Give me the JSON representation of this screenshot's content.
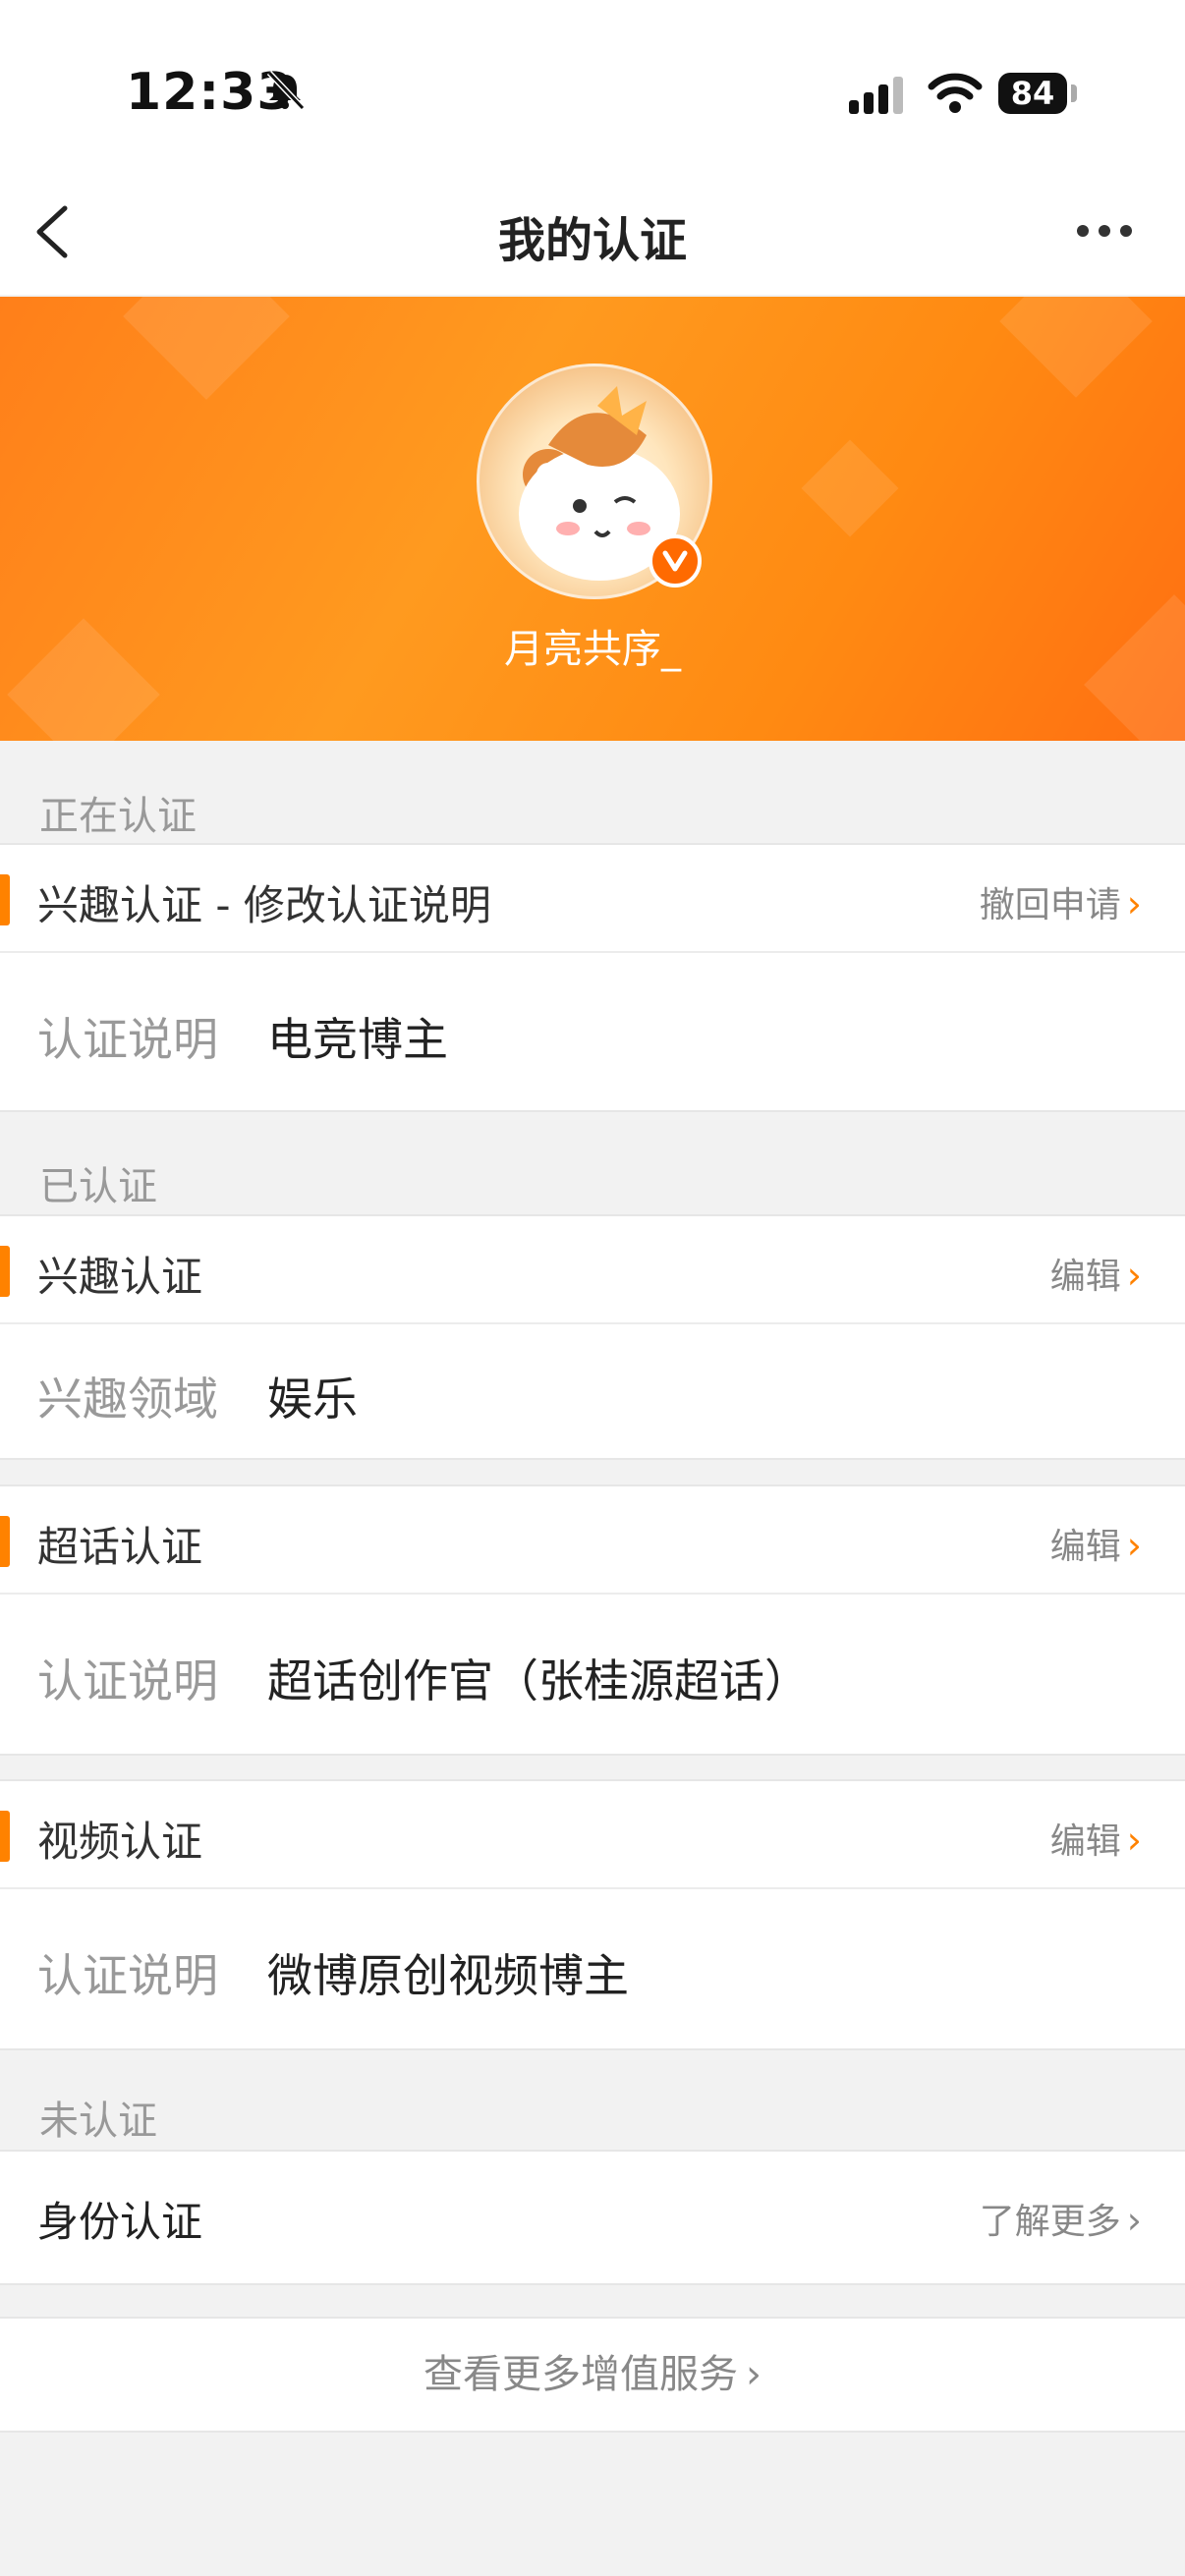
{
  "status_bar": {
    "time": "12:33",
    "battery": "84"
  },
  "nav": {
    "title": "我的认证",
    "back_icon": "chevron-left-icon",
    "more_icon": "more-dots-icon"
  },
  "profile": {
    "username": "月亮共序_",
    "verified_badge": "V"
  },
  "sections": {
    "in_progress": {
      "label": "正在认证",
      "card": {
        "title": "兴趣认证 - 修改认证说明",
        "action": "撤回申请",
        "detail_label": "认证说明",
        "detail_value": "电竞博主"
      }
    },
    "verified": {
      "label": "已认证",
      "cards": [
        {
          "title": "兴趣认证",
          "action": "编辑",
          "detail_label": "兴趣领域",
          "detail_value": "娱乐"
        },
        {
          "title": "超话认证",
          "action": "编辑",
          "detail_label": "认证说明",
          "detail_value": "超话创作官（张桂源超话）"
        },
        {
          "title": "视频认证",
          "action": "编辑",
          "detail_label": "认证说明",
          "detail_value": "微博原创视频博主"
        }
      ]
    },
    "unverified": {
      "label": "未认证",
      "item": {
        "title": "身份认证",
        "action": "了解更多"
      }
    }
  },
  "footer": {
    "more_services": "查看更多增值服务"
  },
  "colors": {
    "accent": "#ff8200",
    "banner": "#ff8a12"
  }
}
